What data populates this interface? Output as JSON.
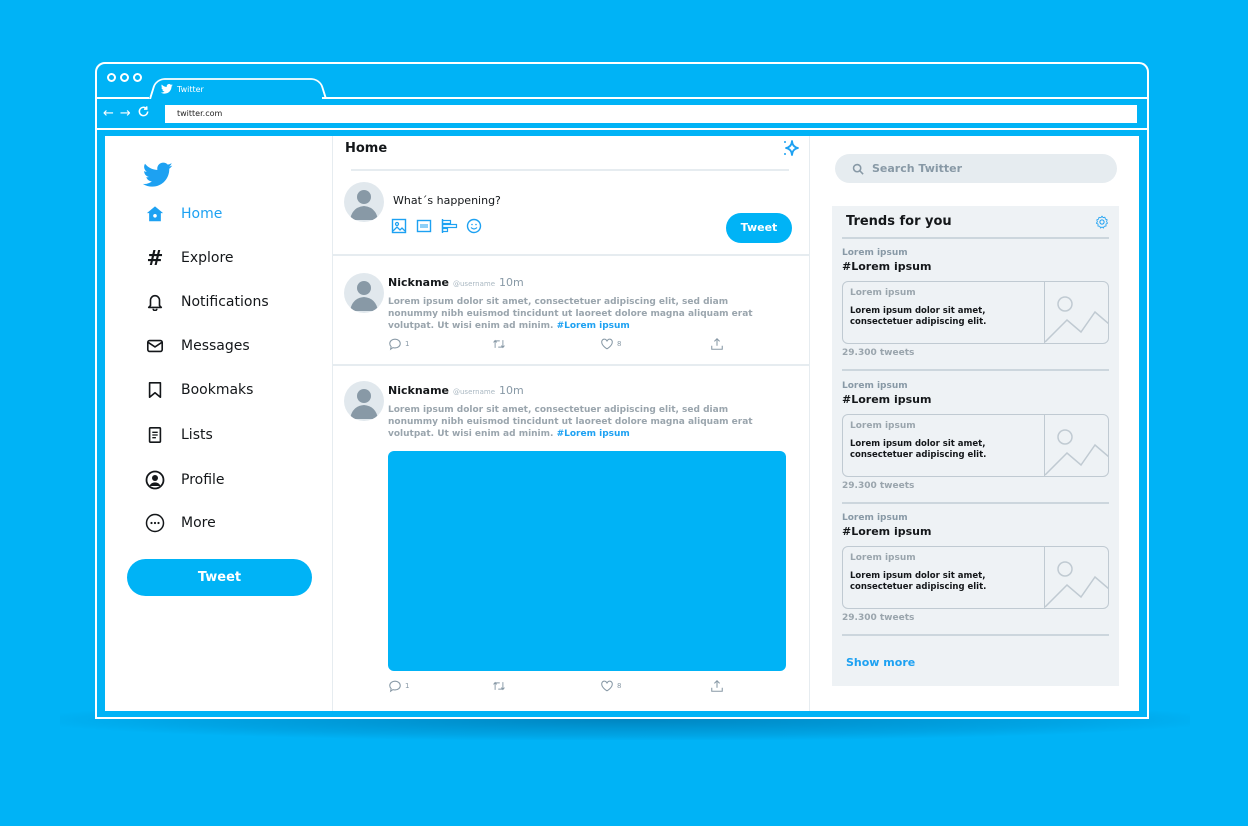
{
  "browser": {
    "tab_title": "Twitter",
    "url": "twitter.com",
    "nav_icons": [
      "back-arrow",
      "forward-arrow",
      "reload"
    ]
  },
  "colors": {
    "background": "#00b3f6",
    "accent": "#1da1f2",
    "button": "#00b3f6",
    "panel": "#eef2f5"
  },
  "sidebar": {
    "items": [
      {
        "label": "Home",
        "icon": "home-icon",
        "active": true
      },
      {
        "label": "Explore",
        "icon": "hashtag-icon",
        "active": false
      },
      {
        "label": "Notifications",
        "icon": "bell-icon",
        "active": false
      },
      {
        "label": "Messages",
        "icon": "envelope-icon",
        "active": false
      },
      {
        "label": "Bookmaks",
        "icon": "bookmark-icon",
        "active": false
      },
      {
        "label": "Lists",
        "icon": "list-icon",
        "active": false
      },
      {
        "label": "Profile",
        "icon": "profile-icon",
        "active": false
      },
      {
        "label": "More",
        "icon": "more-icon",
        "active": false
      }
    ],
    "tweet_button": "Tweet"
  },
  "feed": {
    "title": "Home",
    "compose": {
      "placeholder": "What´s happening?",
      "tweet_button": "Tweet"
    },
    "tweets": [
      {
        "nickname": "Nickname",
        "username": "@username",
        "time": "10m",
        "text": "Lorem ipsum dolor sit amet, consectetuer adipiscing elit, sed diam nonummy nibh euismod tincidunt ut laoreet dolore magna aliquam erat volutpat. Ut wisi enim ad minim.",
        "hashtag": "#Lorem ipsum",
        "replies": "1",
        "likes": "8"
      },
      {
        "nickname": "Nickname",
        "username": "@username",
        "time": "10m",
        "text": "Lorem ipsum dolor sit amet, consectetuer adipiscing elit, sed diam nonummy nibh euismod tincidunt ut laoreet dolore magna aliquam erat volutpat. Ut wisi enim ad minim.",
        "hashtag": "#Lorem ipsum",
        "replies": "1",
        "likes": "8"
      }
    ]
  },
  "right": {
    "search_placeholder": "Search Twitter",
    "trends_title": "Trends for you",
    "trends": [
      {
        "category": "Lorem ipsum",
        "tag": "#Lorem ipsum",
        "card_category": "Lorem ipsum",
        "card_text": "Lorem ipsum dolor sit amet, consectetuer adipiscing elit.",
        "count": "29.300 tweets"
      },
      {
        "category": "Lorem ipsum",
        "tag": "#Lorem ipsum",
        "card_category": "Lorem ipsum",
        "card_text": "Lorem ipsum dolor sit amet, consectetuer adipiscing elit.",
        "count": "29.300 tweets"
      },
      {
        "category": "Lorem ipsum",
        "tag": "#Lorem ipsum",
        "card_category": "Lorem ipsum",
        "card_text": "Lorem ipsum dolor sit amet, consectetuer adipiscing elit.",
        "count": "29.300 tweets"
      }
    ],
    "show_more": "Show more"
  }
}
